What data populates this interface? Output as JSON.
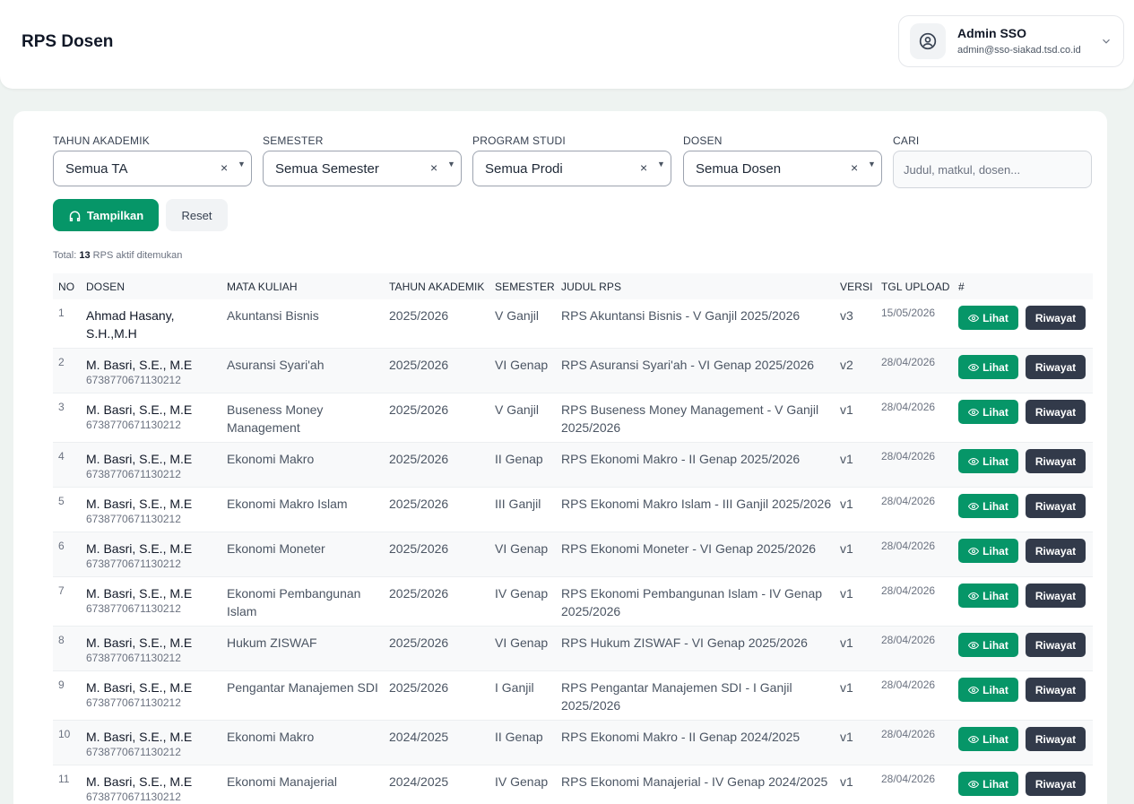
{
  "header": {
    "title": "RPS Dosen",
    "user": {
      "name": "Admin SSO",
      "email": "admin@sso-siakad.tsd.co.id"
    }
  },
  "filters": {
    "tahun_label": "TAHUN AKADEMIK",
    "tahun_value": "Semua TA",
    "semester_label": "SEMESTER",
    "semester_value": "Semua Semester",
    "prodi_label": "PROGRAM STUDI",
    "prodi_value": "Semua Prodi",
    "dosen_label": "DOSEN",
    "dosen_value": "Semua Dosen",
    "cari_label": "CARI",
    "cari_placeholder": "Judul, matkul, dosen...",
    "clear_glyph": "×",
    "caret_glyph": "▼"
  },
  "buttons": {
    "tampilkan": "Tampilkan",
    "reset": "Reset"
  },
  "summary": {
    "prefix": "Total:",
    "count": "13",
    "suffix": "RPS aktif ditemukan"
  },
  "table": {
    "columns": [
      "NO",
      "DOSEN",
      "MATA KULIAH",
      "TAHUN AKADEMIK",
      "SEMESTER",
      "JUDUL RPS",
      "VERSI",
      "TGL UPLOAD",
      "#"
    ],
    "action_lihat": "Lihat",
    "action_riwayat": "Riwayat",
    "rows": [
      {
        "no": "1",
        "dosen": "Ahmad Hasany, S.H.,M.H",
        "nip": "",
        "matkul": "Akuntansi Bisnis",
        "ta": "2025/2026",
        "semester": "V Ganjil",
        "judul": "RPS Akuntansi Bisnis - V Ganjil 2025/2026",
        "versi": "v3",
        "tgl": "15/05/2026"
      },
      {
        "no": "2",
        "dosen": "M. Basri, S.E., M.E",
        "nip": "6738770671130212",
        "matkul": "Asuransi Syari'ah",
        "ta": "2025/2026",
        "semester": "VI Genap",
        "judul": "RPS Asuransi Syari'ah - VI Genap 2025/2026",
        "versi": "v2",
        "tgl": "28/04/2026"
      },
      {
        "no": "3",
        "dosen": "M. Basri, S.E., M.E",
        "nip": "6738770671130212",
        "matkul": "Buseness Money Management",
        "ta": "2025/2026",
        "semester": "V Ganjil",
        "judul": "RPS Buseness Money Management - V Ganjil 2025/2026",
        "versi": "v1",
        "tgl": "28/04/2026"
      },
      {
        "no": "4",
        "dosen": "M. Basri, S.E., M.E",
        "nip": "6738770671130212",
        "matkul": "Ekonomi Makro",
        "ta": "2025/2026",
        "semester": "II Genap",
        "judul": "RPS Ekonomi Makro - II Genap 2025/2026",
        "versi": "v1",
        "tgl": "28/04/2026"
      },
      {
        "no": "5",
        "dosen": "M. Basri, S.E., M.E",
        "nip": "6738770671130212",
        "matkul": "Ekonomi Makro Islam",
        "ta": "2025/2026",
        "semester": "III Ganjil",
        "judul": "RPS Ekonomi Makro Islam - III Ganjil 2025/2026",
        "versi": "v1",
        "tgl": "28/04/2026"
      },
      {
        "no": "6",
        "dosen": "M. Basri, S.E., M.E",
        "nip": "6738770671130212",
        "matkul": "Ekonomi Moneter",
        "ta": "2025/2026",
        "semester": "VI Genap",
        "judul": "RPS Ekonomi Moneter - VI Genap 2025/2026",
        "versi": "v1",
        "tgl": "28/04/2026"
      },
      {
        "no": "7",
        "dosen": "M. Basri, S.E., M.E",
        "nip": "6738770671130212",
        "matkul": "Ekonomi Pembangunan Islam",
        "ta": "2025/2026",
        "semester": "IV Genap",
        "judul": "RPS Ekonomi Pembangunan Islam - IV Genap 2025/2026",
        "versi": "v1",
        "tgl": "28/04/2026"
      },
      {
        "no": "8",
        "dosen": "M. Basri, S.E., M.E",
        "nip": "6738770671130212",
        "matkul": "Hukum ZISWAF",
        "ta": "2025/2026",
        "semester": "VI Genap",
        "judul": "RPS Hukum ZISWAF - VI Genap 2025/2026",
        "versi": "v1",
        "tgl": "28/04/2026"
      },
      {
        "no": "9",
        "dosen": "M. Basri, S.E., M.E",
        "nip": "6738770671130212",
        "matkul": "Pengantar Manajemen SDI",
        "ta": "2025/2026",
        "semester": "I Ganjil",
        "judul": "RPS Pengantar Manajemen SDI - I Ganjil 2025/2026",
        "versi": "v1",
        "tgl": "28/04/2026"
      },
      {
        "no": "10",
        "dosen": "M. Basri, S.E., M.E",
        "nip": "6738770671130212",
        "matkul": "Ekonomi Makro",
        "ta": "2024/2025",
        "semester": "II Genap",
        "judul": "RPS Ekonomi Makro - II Genap 2024/2025",
        "versi": "v1",
        "tgl": "28/04/2026"
      },
      {
        "no": "11",
        "dosen": "M. Basri, S.E., M.E",
        "nip": "6738770671130212",
        "matkul": "Ekonomi Manajerial",
        "ta": "2024/2025",
        "semester": "IV Genap",
        "judul": "RPS Ekonomi Manajerial - IV Genap 2024/2025",
        "versi": "v1",
        "tgl": "28/04/2026"
      }
    ]
  },
  "colors": {
    "primary": "#069668",
    "dark": "#323a4a"
  }
}
